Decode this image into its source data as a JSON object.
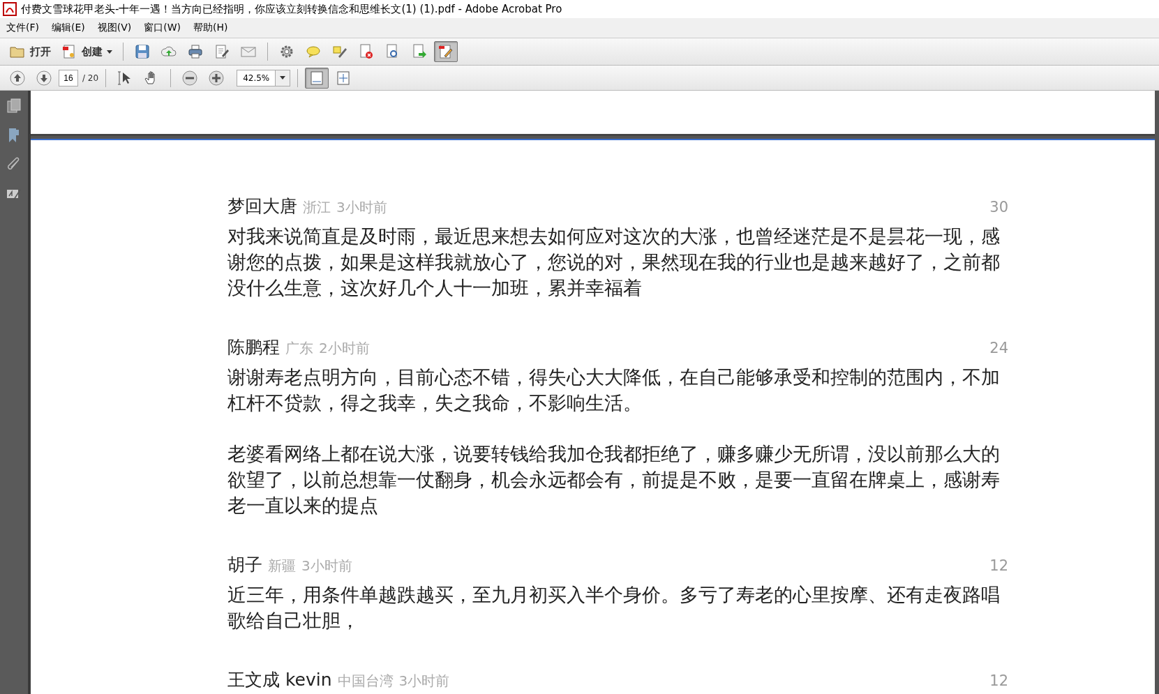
{
  "window": {
    "title": "付费文雪球花甲老头-十年一遇！当方向已经指明，你应该立刻转换信念和思维长文(1) (1).pdf - Adobe Acrobat Pro"
  },
  "menu": [
    "文件(F)",
    "编辑(E)",
    "视图(V)",
    "窗口(W)",
    "帮助(H)"
  ],
  "toolbar": [
    {
      "kind": "open",
      "label": "打开",
      "pressed": false
    },
    {
      "kind": "create",
      "label": "创建",
      "pressed": false
    },
    {
      "kind": "save",
      "pressed": false
    },
    {
      "kind": "upload",
      "pressed": false
    },
    {
      "kind": "print",
      "pressed": false
    },
    {
      "kind": "edit",
      "pressed": false
    },
    {
      "kind": "mail",
      "pressed": false
    },
    {
      "kind": "gear",
      "pressed": false
    },
    {
      "kind": "comment",
      "pressed": false
    },
    {
      "kind": "highlight",
      "pressed": false
    },
    {
      "kind": "docx",
      "pressed": false
    },
    {
      "kind": "docsearch",
      "pressed": false
    },
    {
      "kind": "docexport",
      "pressed": false
    },
    {
      "kind": "docedit",
      "pressed": true
    }
  ],
  "nav": {
    "page": "16",
    "total": "/ 20",
    "zoom": "42.5%"
  },
  "comments": [
    {
      "name": "梦回大唐",
      "location": "浙江",
      "time": "3小时前",
      "likes": "30",
      "paragraphs": [
        "对我来说简直是及时雨，最近思来想去如何应对这次的大涨，也曾经迷茫是不是昙花一现，感谢您的点拨，如果是这样我就放心了，您说的对，果然现在我的行业也是越来越好了，之前都没什么生意，这次好几个人十一加班，累并幸福着"
      ]
    },
    {
      "name": "陈鹏程",
      "location": "广东",
      "time": "2小时前",
      "likes": "24",
      "paragraphs": [
        "谢谢寿老点明方向，目前心态不错，得失心大大降低，在自己能够承受和控制的范围内，不加杠杆不贷款，得之我幸，失之我命，不影响生活。",
        "老婆看网络上都在说大涨，说要转钱给我加仓我都拒绝了，赚多赚少无所谓，没以前那么大的欲望了，以前总想靠一仗翻身，机会永远都会有，前提是不败，是要一直留在牌桌上，感谢寿老一直以来的提点"
      ]
    },
    {
      "name": "胡子",
      "location": "新疆",
      "time": "3小时前",
      "likes": "12",
      "paragraphs": [
        "近三年，用条件单越跌越买，至九月初买入半个身价。多亏了寿老的心里按摩、还有走夜路唱歌给自己壮胆，"
      ]
    },
    {
      "name": "王文成 kevin",
      "location": "中国台湾",
      "time": "3小时前",
      "likes": "12"
    }
  ]
}
